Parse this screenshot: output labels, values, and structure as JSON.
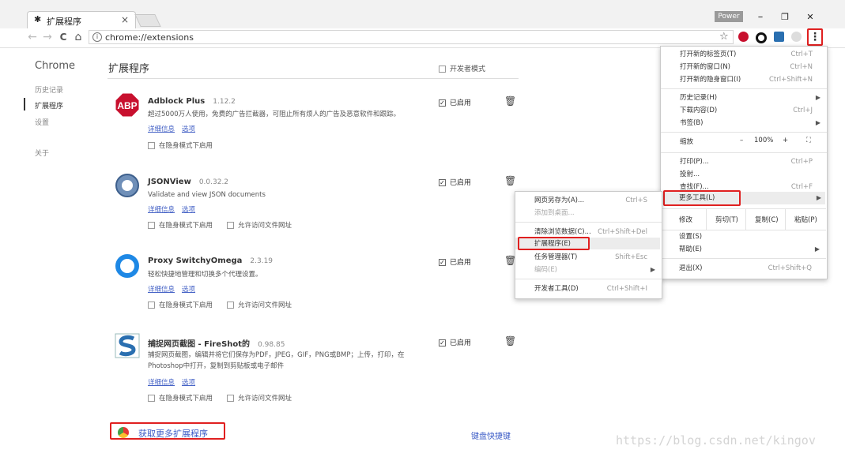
{
  "window": {
    "tab_title": "扩展程序",
    "tab_close": "×",
    "profile_badge": "Power",
    "minimize": "–",
    "restore": "❐",
    "close": "✕"
  },
  "toolbar": {
    "back": "←",
    "forward": "→",
    "reload": "C",
    "home": "⌂",
    "url": "chrome://extensions",
    "bookmark_star": "☆",
    "menu_icon": "⋮"
  },
  "sidebar": {
    "title": "Chrome",
    "items": [
      {
        "label": "历史记录"
      },
      {
        "label": "扩展程序"
      },
      {
        "label": "设置"
      },
      {
        "label": "关于"
      }
    ]
  },
  "main": {
    "title": "扩展程序",
    "dev_mode_label": "开发者模式",
    "dev_mode_checked": false,
    "enabled_label": "已启用",
    "details_link": "详细信息",
    "options_link": "选项",
    "incognito_label": "在隐身模式下启用",
    "file_access_label": "允许访问文件网址",
    "extensions": [
      {
        "name": "Adblock Plus",
        "version": "1.12.2",
        "desc": "超过5000万人使用，免费的广告拦截器，可阻止所有烦人的广告及恶意软件和跟踪。",
        "icon": "abp-stop-sign-icon",
        "enabled": true,
        "show_file_access": false
      },
      {
        "name": "JSONView",
        "version": "0.0.32.2",
        "desc": "Validate and view JSON documents",
        "icon": "jsonview-ring-icon",
        "enabled": true,
        "show_file_access": true
      },
      {
        "name": "Proxy SwitchyOmega",
        "version": "2.3.19",
        "desc": "轻松快捷地管理和切换多个代理设置。",
        "icon": "switchyomega-ring-icon",
        "enabled": true,
        "show_file_access": true
      },
      {
        "name": "捕捉网页截图 - FireShot的",
        "version": "0.98.85",
        "desc": "捕捉网页截图，编辑并将它们保存为PDF，JPEG，GIF，PNG或BMP；上传，打印，在Photoshop中打开，复制到剪贴板或电子邮件",
        "icon": "fireshot-s-icon",
        "enabled": true,
        "show_file_access": true
      }
    ],
    "get_more": "获取更多扩展程序",
    "keyboard_shortcuts": "键盘快捷键"
  },
  "main_menu": {
    "new_tab": {
      "label": "打开新的标签页(T)",
      "shortcut": "Ctrl+T"
    },
    "new_window": {
      "label": "打开新的窗口(N)",
      "shortcut": "Ctrl+N"
    },
    "new_incognito": {
      "label": "打开新的隐身窗口(I)",
      "shortcut": "Ctrl+Shift+N"
    },
    "history": {
      "label": "历史记录(H)"
    },
    "downloads": {
      "label": "下载内容(D)",
      "shortcut": "Ctrl+J"
    },
    "bookmarks": {
      "label": "书签(B)"
    },
    "zoom": {
      "label": "缩放",
      "minus": "–",
      "value": "100%",
      "plus": "+",
      "fullscreen": "⛶"
    },
    "print": {
      "label": "打印(P)...",
      "shortcut": "Ctrl+P"
    },
    "cast": {
      "label": "投射..."
    },
    "find": {
      "label": "查找(F)...",
      "shortcut": "Ctrl+F"
    },
    "more_tools": {
      "label": "更多工具(L)"
    },
    "edit": {
      "label": "修改",
      "cut": "剪切(T)",
      "copy": "复制(C)",
      "paste": "粘贴(P)"
    },
    "settings": {
      "label": "设置(S)"
    },
    "help": {
      "label": "帮助(E)"
    },
    "exit": {
      "label": "退出(X)",
      "shortcut": "Ctrl+Shift+Q"
    }
  },
  "sub_menu": {
    "save_page": {
      "label": "网页另存为(A)...",
      "shortcut": "Ctrl+S"
    },
    "add_to_desktop": {
      "label": "添加到桌面..."
    },
    "clear_data": {
      "label": "清除浏览数据(C)...",
      "shortcut": "Ctrl+Shift+Del"
    },
    "extensions": {
      "label": "扩展程序(E)"
    },
    "task_manager": {
      "label": "任务管理器(T)",
      "shortcut": "Shift+Esc"
    },
    "encoding": {
      "label": "编码(E)"
    },
    "dev_tools": {
      "label": "开发者工具(D)",
      "shortcut": "Ctrl+Shift+I"
    }
  },
  "watermark": "https://blog.csdn.net/kingov",
  "colors": {
    "highlight_border": "#e02020",
    "link_blue": "#4663c6",
    "abp_red": "#c8102e",
    "switchy_blue": "#1e88e5",
    "fireshot_blue": "#2a6fb0"
  }
}
